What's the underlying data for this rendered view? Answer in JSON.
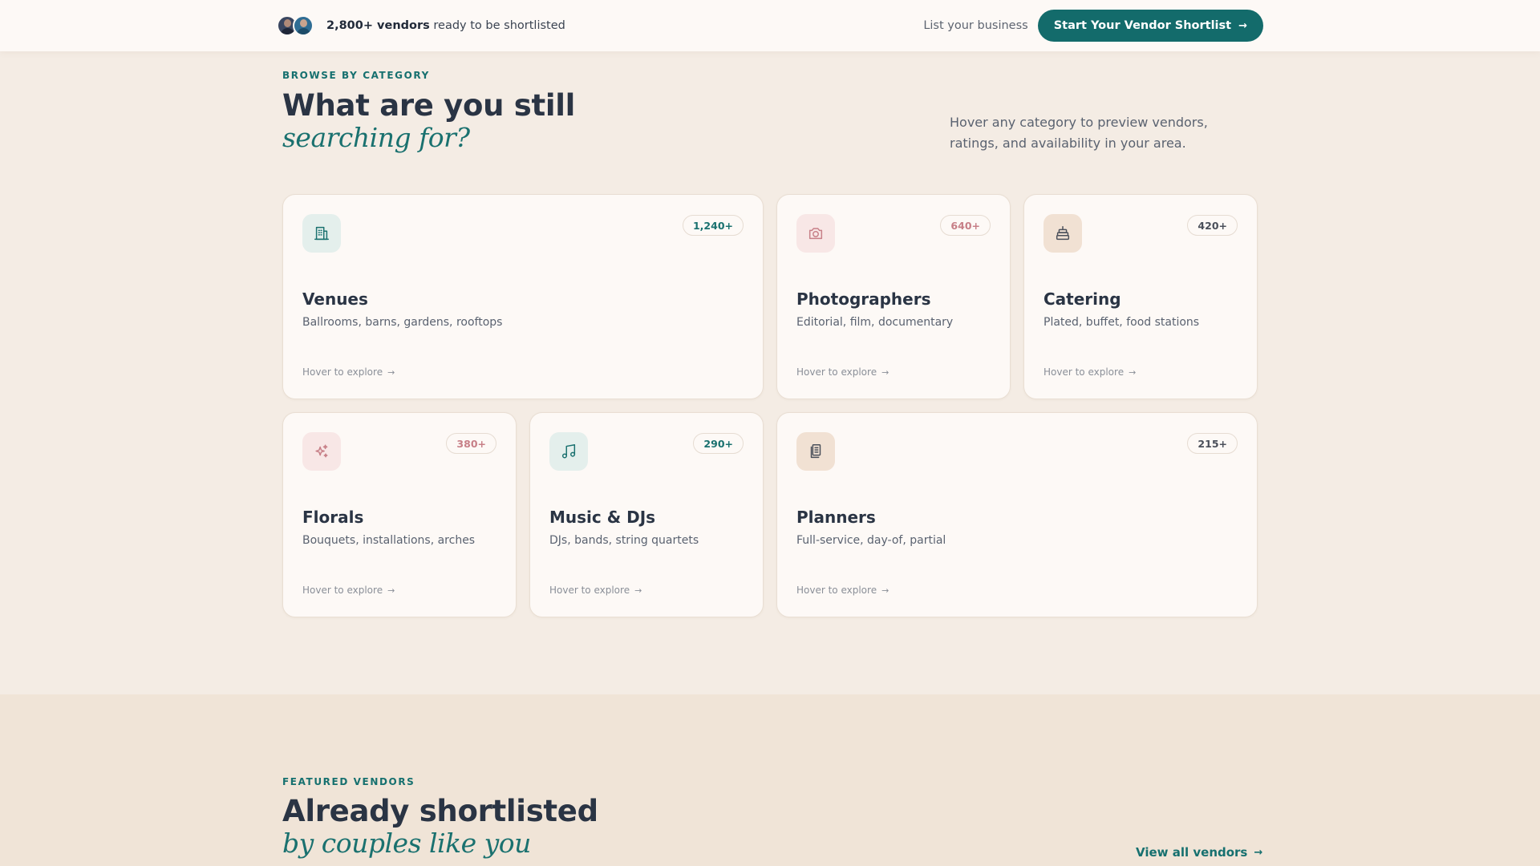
{
  "topbar": {
    "vendors_count": "2,800+ vendors",
    "vendors_suffix": " ready to be shortlisted",
    "list_business": "List your business",
    "cta_label": "Start Your Vendor Shortlist",
    "cta_icon": "arrow-right-icon"
  },
  "category_section": {
    "eyebrow": "BROWSE BY CATEGORY",
    "title": "What are you still",
    "title_italic": "searching for?",
    "intro": "Hover any category to preview vendors, ratings, and availability in your area."
  },
  "categories": [
    {
      "title": "Venues",
      "subtitle": "Ballrooms, barns, gardens, rooftops",
      "count": "1,240+",
      "hint": "Hover to explore",
      "icon": "building-icon",
      "accent": "#1a716f"
    },
    {
      "title": "Photographers",
      "subtitle": "Editorial, film, documentary",
      "count": "640+",
      "hint": "Hover to explore",
      "icon": "camera-icon",
      "accent": "#c77f87"
    },
    {
      "title": "Catering",
      "subtitle": "Plated, buffet, food stations",
      "count": "420+",
      "hint": "Hover to explore",
      "icon": "cake-icon",
      "accent": "#4a4f5a"
    },
    {
      "title": "Florals",
      "subtitle": "Bouquets, installations, arches",
      "count": "380+",
      "hint": "Hover to explore",
      "icon": "sparkles-icon",
      "accent": "#c77f87"
    },
    {
      "title": "Music & DJs",
      "subtitle": "DJs, bands, string quartets",
      "count": "290+",
      "hint": "Hover to explore",
      "icon": "music-note-icon",
      "accent": "#1a716f"
    },
    {
      "title": "Planners",
      "subtitle": "Full-service, day-of, partial",
      "count": "215+",
      "hint": "Hover to explore",
      "icon": "clipboard-icon",
      "accent": "#4a4f5a"
    }
  ],
  "featured_section": {
    "eyebrow": "FEATURED VENDORS",
    "title": "Already shortlisted",
    "title_italic": "by couples like you",
    "view_all": "View all vendors"
  },
  "colors": {
    "brand_teal": "#136b6b",
    "background": "#f4ece4",
    "card": "#fdf9f6",
    "accent_pink": "#c77f87"
  }
}
